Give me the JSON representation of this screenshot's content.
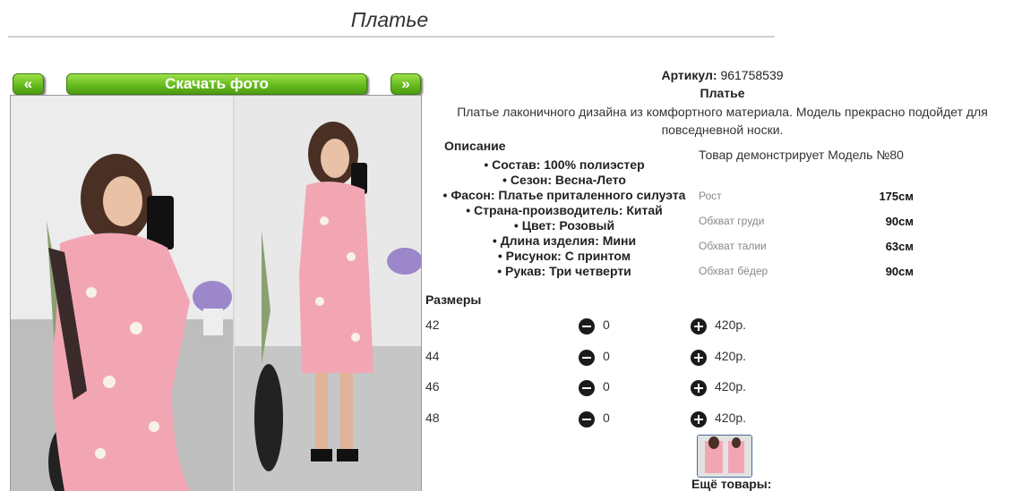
{
  "page": {
    "title": "Платье"
  },
  "gallery": {
    "prev_label": "«",
    "download_label": "Скачать фото",
    "next_label": "»"
  },
  "product": {
    "article_label": "Артикул:",
    "article_value": "961758539",
    "name": "Платье",
    "description": "Платье лаконичного дизайна из комфортного материала. Модель прекрасно подойдет для повседневной носки.",
    "description_heading": "Описание",
    "properties": [
      "Состав: 100% полиэстер",
      "Сезон: Весна-Лето",
      "Фасон: Платье приталенного силуэта",
      "Страна-производитель: Китай",
      "Цвет: Розовый",
      "Длина изделия: Мини",
      "Рисунок: С принтом",
      "Рукав: Три четверти"
    ]
  },
  "model": {
    "caption": "Товар демонстрирует Модель №80",
    "measurements": [
      {
        "label": "Рост",
        "value": "175см"
      },
      {
        "label": "Обхват груди",
        "value": "90см"
      },
      {
        "label": "Обхват талии",
        "value": "63см"
      },
      {
        "label": "Обхват бёдер",
        "value": "90см"
      }
    ]
  },
  "sizes": {
    "heading": "Размеры",
    "rows": [
      {
        "size": "42",
        "qty": "0",
        "price": "420р."
      },
      {
        "size": "44",
        "qty": "0",
        "price": "420р."
      },
      {
        "size": "46",
        "qty": "0",
        "price": "420р."
      },
      {
        "size": "48",
        "qty": "0",
        "price": "420р."
      }
    ]
  },
  "footer": {
    "more_label": "Ещё товары:"
  },
  "colors": {
    "button_green": "#66bb1e",
    "dress_pink": "#f2a6b4",
    "title_rule": "#cfcfcf"
  }
}
